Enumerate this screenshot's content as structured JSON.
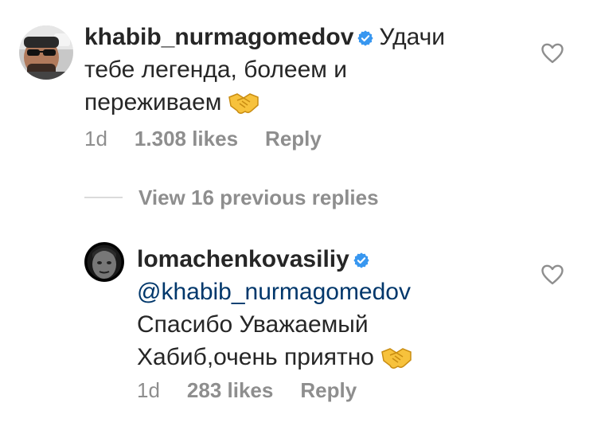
{
  "comments": [
    {
      "username": "khabib_nurmagomedov",
      "verified": true,
      "text_line1": "Удачи",
      "text_line2": "тебе легенда, болеем и",
      "text_line3": "переживаем",
      "emoji": "handshake",
      "time": "1d",
      "likes": "1.308 likes",
      "reply_label": "Reply",
      "avatar_icon": "user-avatar-sunglasses",
      "like_icon": "heart-outline"
    },
    {
      "username": "lomachenkovasiliy",
      "verified": true,
      "mention": "@khabib_nurmagomedov",
      "text_line1": "Спасибо Уважаемый",
      "text_line2": "Хабиб,очень приятно",
      "emoji": "handshake",
      "time": "1d",
      "likes": "283 likes",
      "reply_label": "Reply",
      "avatar_icon": "user-avatar-bw",
      "like_icon": "heart-outline"
    }
  ],
  "view_replies": "View 16 previous replies",
  "colors": {
    "text": "#262626",
    "muted": "#8e8e8e",
    "mention": "#00376b",
    "verified": "#3897f0",
    "divider": "#dbdbdb"
  }
}
